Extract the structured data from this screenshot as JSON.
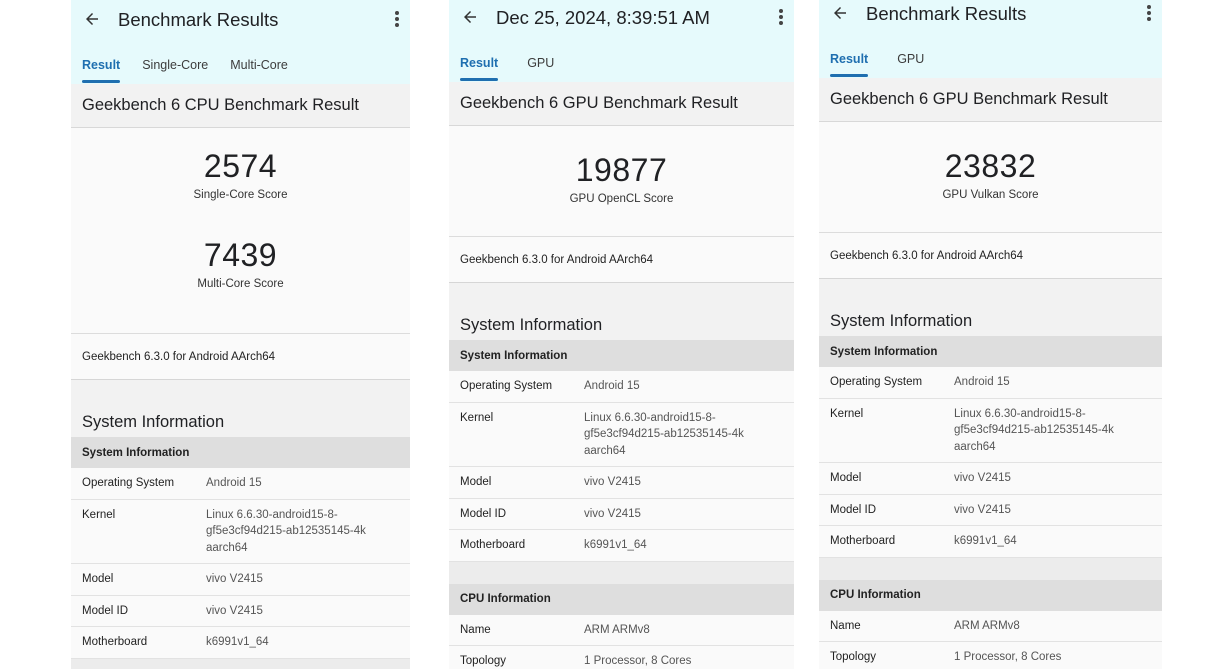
{
  "panel1": {
    "title": "Benchmark Results",
    "tabs": [
      {
        "label": "Result"
      },
      {
        "label": "Single-Core"
      },
      {
        "label": "Multi-Core"
      }
    ],
    "result_title": "Geekbench 6 CPU Benchmark Result",
    "scores": [
      {
        "value": "2574",
        "label": "Single-Core Score"
      },
      {
        "value": "7439",
        "label": "Multi-Core Score"
      }
    ],
    "version": "Geekbench 6.3.0 for Android AArch64",
    "system_heading": "System Information",
    "system_subheading": "System Information",
    "system_rows": [
      {
        "key": "Operating System",
        "value": "Android 15"
      },
      {
        "key": "Kernel",
        "value": "Linux 6.6.30-android15-8-gf5e3cf94d215-ab12535145-4k aarch64"
      },
      {
        "key": "Model",
        "value": "vivo V2415"
      },
      {
        "key": "Model ID",
        "value": "vivo V2415"
      },
      {
        "key": "Motherboard",
        "value": "k6991v1_64"
      }
    ]
  },
  "panel2": {
    "title": "Dec 25, 2024, 8:39:51 AM",
    "tabs": [
      {
        "label": "Result"
      },
      {
        "label": "GPU"
      }
    ],
    "result_title": "Geekbench 6 GPU Benchmark Result",
    "score": {
      "value": "19877",
      "label": "GPU OpenCL Score"
    },
    "version": "Geekbench 6.3.0 for Android AArch64",
    "system_heading": "System Information",
    "system_subheading": "System Information",
    "system_rows": [
      {
        "key": "Operating System",
        "value": "Android 15"
      },
      {
        "key": "Kernel",
        "value": "Linux 6.6.30-android15-8-gf5e3cf94d215-ab12535145-4k aarch64"
      },
      {
        "key": "Model",
        "value": "vivo V2415"
      },
      {
        "key": "Model ID",
        "value": "vivo V2415"
      },
      {
        "key": "Motherboard",
        "value": "k6991v1_64"
      }
    ],
    "cpu_subheading": "CPU Information",
    "cpu_rows": [
      {
        "key": "Name",
        "value": "ARM ARMv8"
      },
      {
        "key": "Topology",
        "value": "1 Processor, 8 Cores"
      }
    ]
  },
  "panel3": {
    "title": "Benchmark Results",
    "tabs": [
      {
        "label": "Result"
      },
      {
        "label": "GPU"
      }
    ],
    "result_title": "Geekbench 6 GPU Benchmark Result",
    "score": {
      "value": "23832",
      "label": "GPU Vulkan Score"
    },
    "version": "Geekbench 6.3.0 for Android AArch64",
    "system_heading": "System Information",
    "system_subheading": "System Information",
    "system_rows": [
      {
        "key": "Operating System",
        "value": "Android 15"
      },
      {
        "key": "Kernel",
        "value": "Linux 6.6.30-android15-8-gf5e3cf94d215-ab12535145-4k aarch64"
      },
      {
        "key": "Model",
        "value": "vivo V2415"
      },
      {
        "key": "Model ID",
        "value": "vivo V2415"
      },
      {
        "key": "Motherboard",
        "value": "k6991v1_64"
      }
    ],
    "cpu_subheading": "CPU Information",
    "cpu_rows": [
      {
        "key": "Name",
        "value": "ARM ARMv8"
      },
      {
        "key": "Topology",
        "value": "1 Processor, 8 Cores"
      }
    ]
  }
}
